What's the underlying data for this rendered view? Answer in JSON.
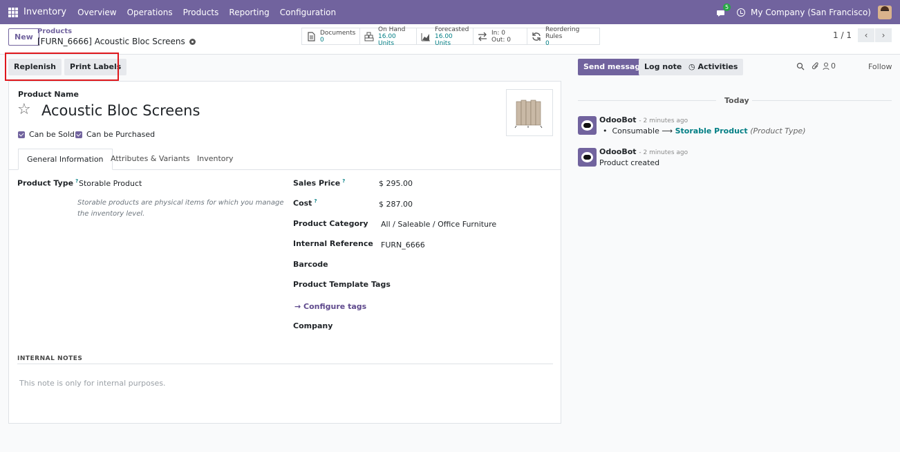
{
  "navbar": {
    "app_name": "Inventory",
    "menus": [
      "Overview",
      "Operations",
      "Products",
      "Reporting",
      "Configuration"
    ],
    "chat_count": "5",
    "company": "My Company (San Francisco)"
  },
  "control": {
    "new_label": "New",
    "breadcrumb_parent": "Products",
    "breadcrumb_current": "[FURN_6666] Acoustic Bloc Screens",
    "smart_buttons": [
      {
        "icon": "documents-icon",
        "label": "Documents",
        "value": "0"
      },
      {
        "icon": "on-hand-icon",
        "label": "On Hand",
        "value": "16.00 Units"
      },
      {
        "icon": "forecasted-icon",
        "label": "Forecasted",
        "value": "16.00 Units"
      },
      {
        "icon": "in-out-icon",
        "label": "In: 0",
        "value": "Out: 0"
      },
      {
        "icon": "reordering-icon",
        "label": "Reordering Rules",
        "value": "0"
      }
    ],
    "pager": "1 / 1"
  },
  "actions": {
    "replenish": "Replenish",
    "print_labels": "Print Labels"
  },
  "form": {
    "product_name_label": "Product Name",
    "product_name": "Acoustic Bloc Screens",
    "can_be_sold": "Can be Sold",
    "can_be_purchased": "Can be Purchased",
    "tabs": [
      "General Information",
      "Attributes & Variants",
      "Inventory"
    ],
    "product_type_label": "Product Type",
    "product_type": "Storable Product",
    "product_type_help": "Storable products are physical items for which you manage the inventory level.",
    "sales_price_label": "Sales Price",
    "sales_price": "$ 295.00",
    "cost_label": "Cost",
    "cost": "$ 287.00",
    "category_label": "Product Category",
    "category": "All / Saleable / Office Furniture",
    "internal_ref_label": "Internal Reference",
    "internal_ref": "FURN_6666",
    "barcode_label": "Barcode",
    "template_tags_label": "Product Template Tags",
    "configure_tags": "Configure tags",
    "company_label": "Company",
    "internal_notes_label": "INTERNAL NOTES",
    "internal_notes_placeholder": "This note is only for internal purposes."
  },
  "chatter": {
    "send_message": "Send message",
    "log_note": "Log note",
    "activities": "Activities",
    "attachments_count": "0",
    "followers_count": "0",
    "follow": "Follow",
    "today": "Today",
    "messages": [
      {
        "author": "OdooBot",
        "time": "- 2 minutes ago",
        "old": "Consumable",
        "new": "Storable Product",
        "field": "(Product Type)"
      },
      {
        "author": "OdooBot",
        "time": "- 2 minutes ago",
        "body": "Product created"
      }
    ]
  }
}
